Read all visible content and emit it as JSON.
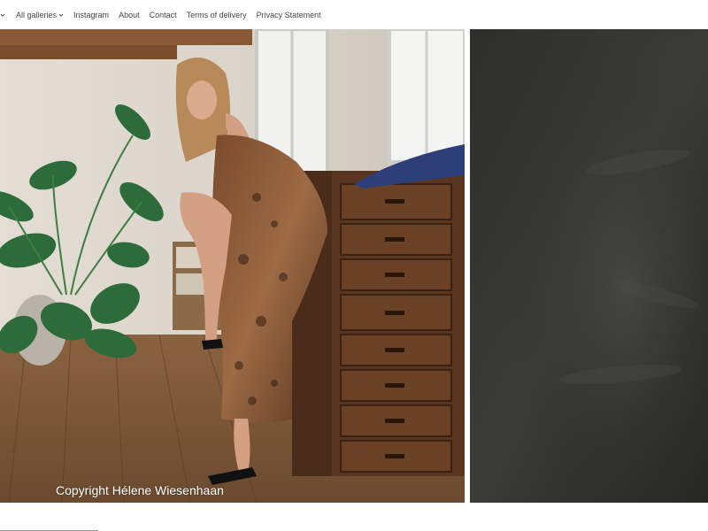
{
  "nav": {
    "items": [
      {
        "label": "All galleries",
        "has_dropdown": true
      },
      {
        "label": "Instagram"
      },
      {
        "label": "About"
      },
      {
        "label": "Contact"
      },
      {
        "label": "Terms of delivery"
      },
      {
        "label": "Privacy Statement"
      }
    ]
  },
  "gallery": {
    "main_photo": {
      "caption": "Copyright Hélene Wiesenhaan",
      "subject": "woman in leopard print dress seated on wooden chest of drawers beside plants"
    },
    "side_photo": {
      "subject": "dark grey textured wall"
    }
  },
  "colors": {
    "nav_text": "#444444",
    "background": "#ffffff",
    "caption_text": "#ffffff"
  },
  "icons": {
    "dropdown": "chevron-down-icon"
  }
}
